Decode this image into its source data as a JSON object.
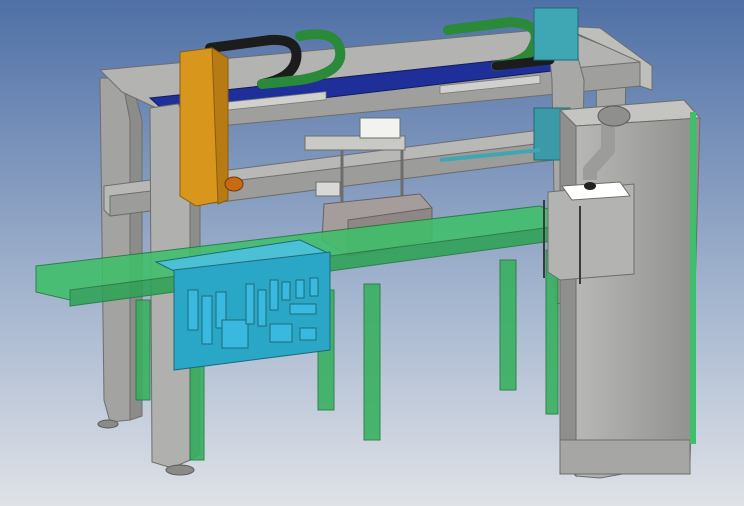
{
  "colors": {
    "background_top": "#5878a8",
    "background_bottom": "#d8dce4",
    "frame_gray": "#a9aaa7",
    "frame_dark": "#7d7e7b",
    "frame_light": "#c9cac6",
    "rail_blue": "#1f2f9a",
    "carriage_orange": "#d8961c",
    "cable_chain_green": "#2a8a3a",
    "cable_chain_black": "#1c1c1c",
    "conveyor_green": "#3fbf6a",
    "panel_teal": "#2aa6c6",
    "component_blue": "#39b8e0",
    "cabinet_gray": "#a6a7a4",
    "welding_head_gray": "#a09a98"
  },
  "icons": {
    "gantry": "gantry-frame-icon",
    "panel": "control-panel-icon",
    "cabinet": "electrical-cabinet-icon"
  }
}
